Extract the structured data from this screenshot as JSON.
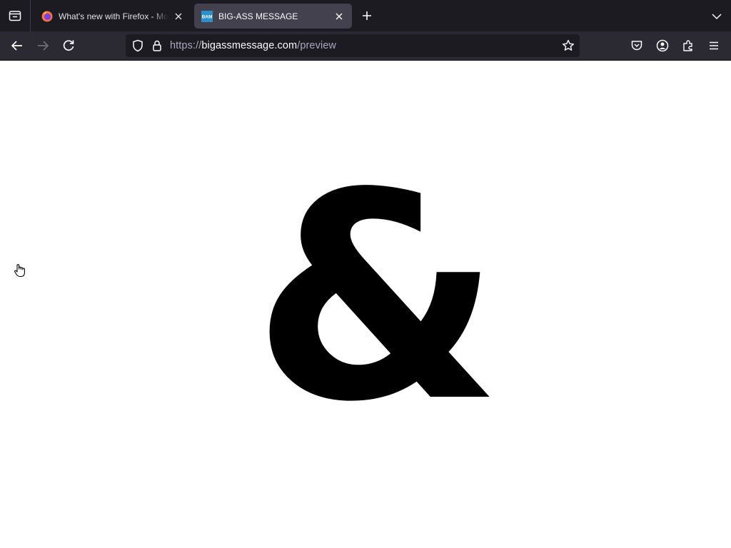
{
  "browser": {
    "tabs": [
      {
        "title": "What's new with Firefox - More",
        "favicon": "firefox-icon",
        "active": false
      },
      {
        "title": "BIG-ASS MESSAGE",
        "favicon": "bam-favicon",
        "favicon_text": "BAM",
        "active": true
      }
    ],
    "url": {
      "scheme": "https://",
      "host": "bigassmessage.com",
      "path": "/preview"
    },
    "colors": {
      "tabbar_bg": "#1c1b22",
      "toolbar_bg": "#2b2a33",
      "active_tab_bg": "#42414d",
      "favicon_blue": "#2b8fc9"
    }
  },
  "page": {
    "message": "&",
    "background": "#ffffff",
    "text_color": "#000000"
  }
}
